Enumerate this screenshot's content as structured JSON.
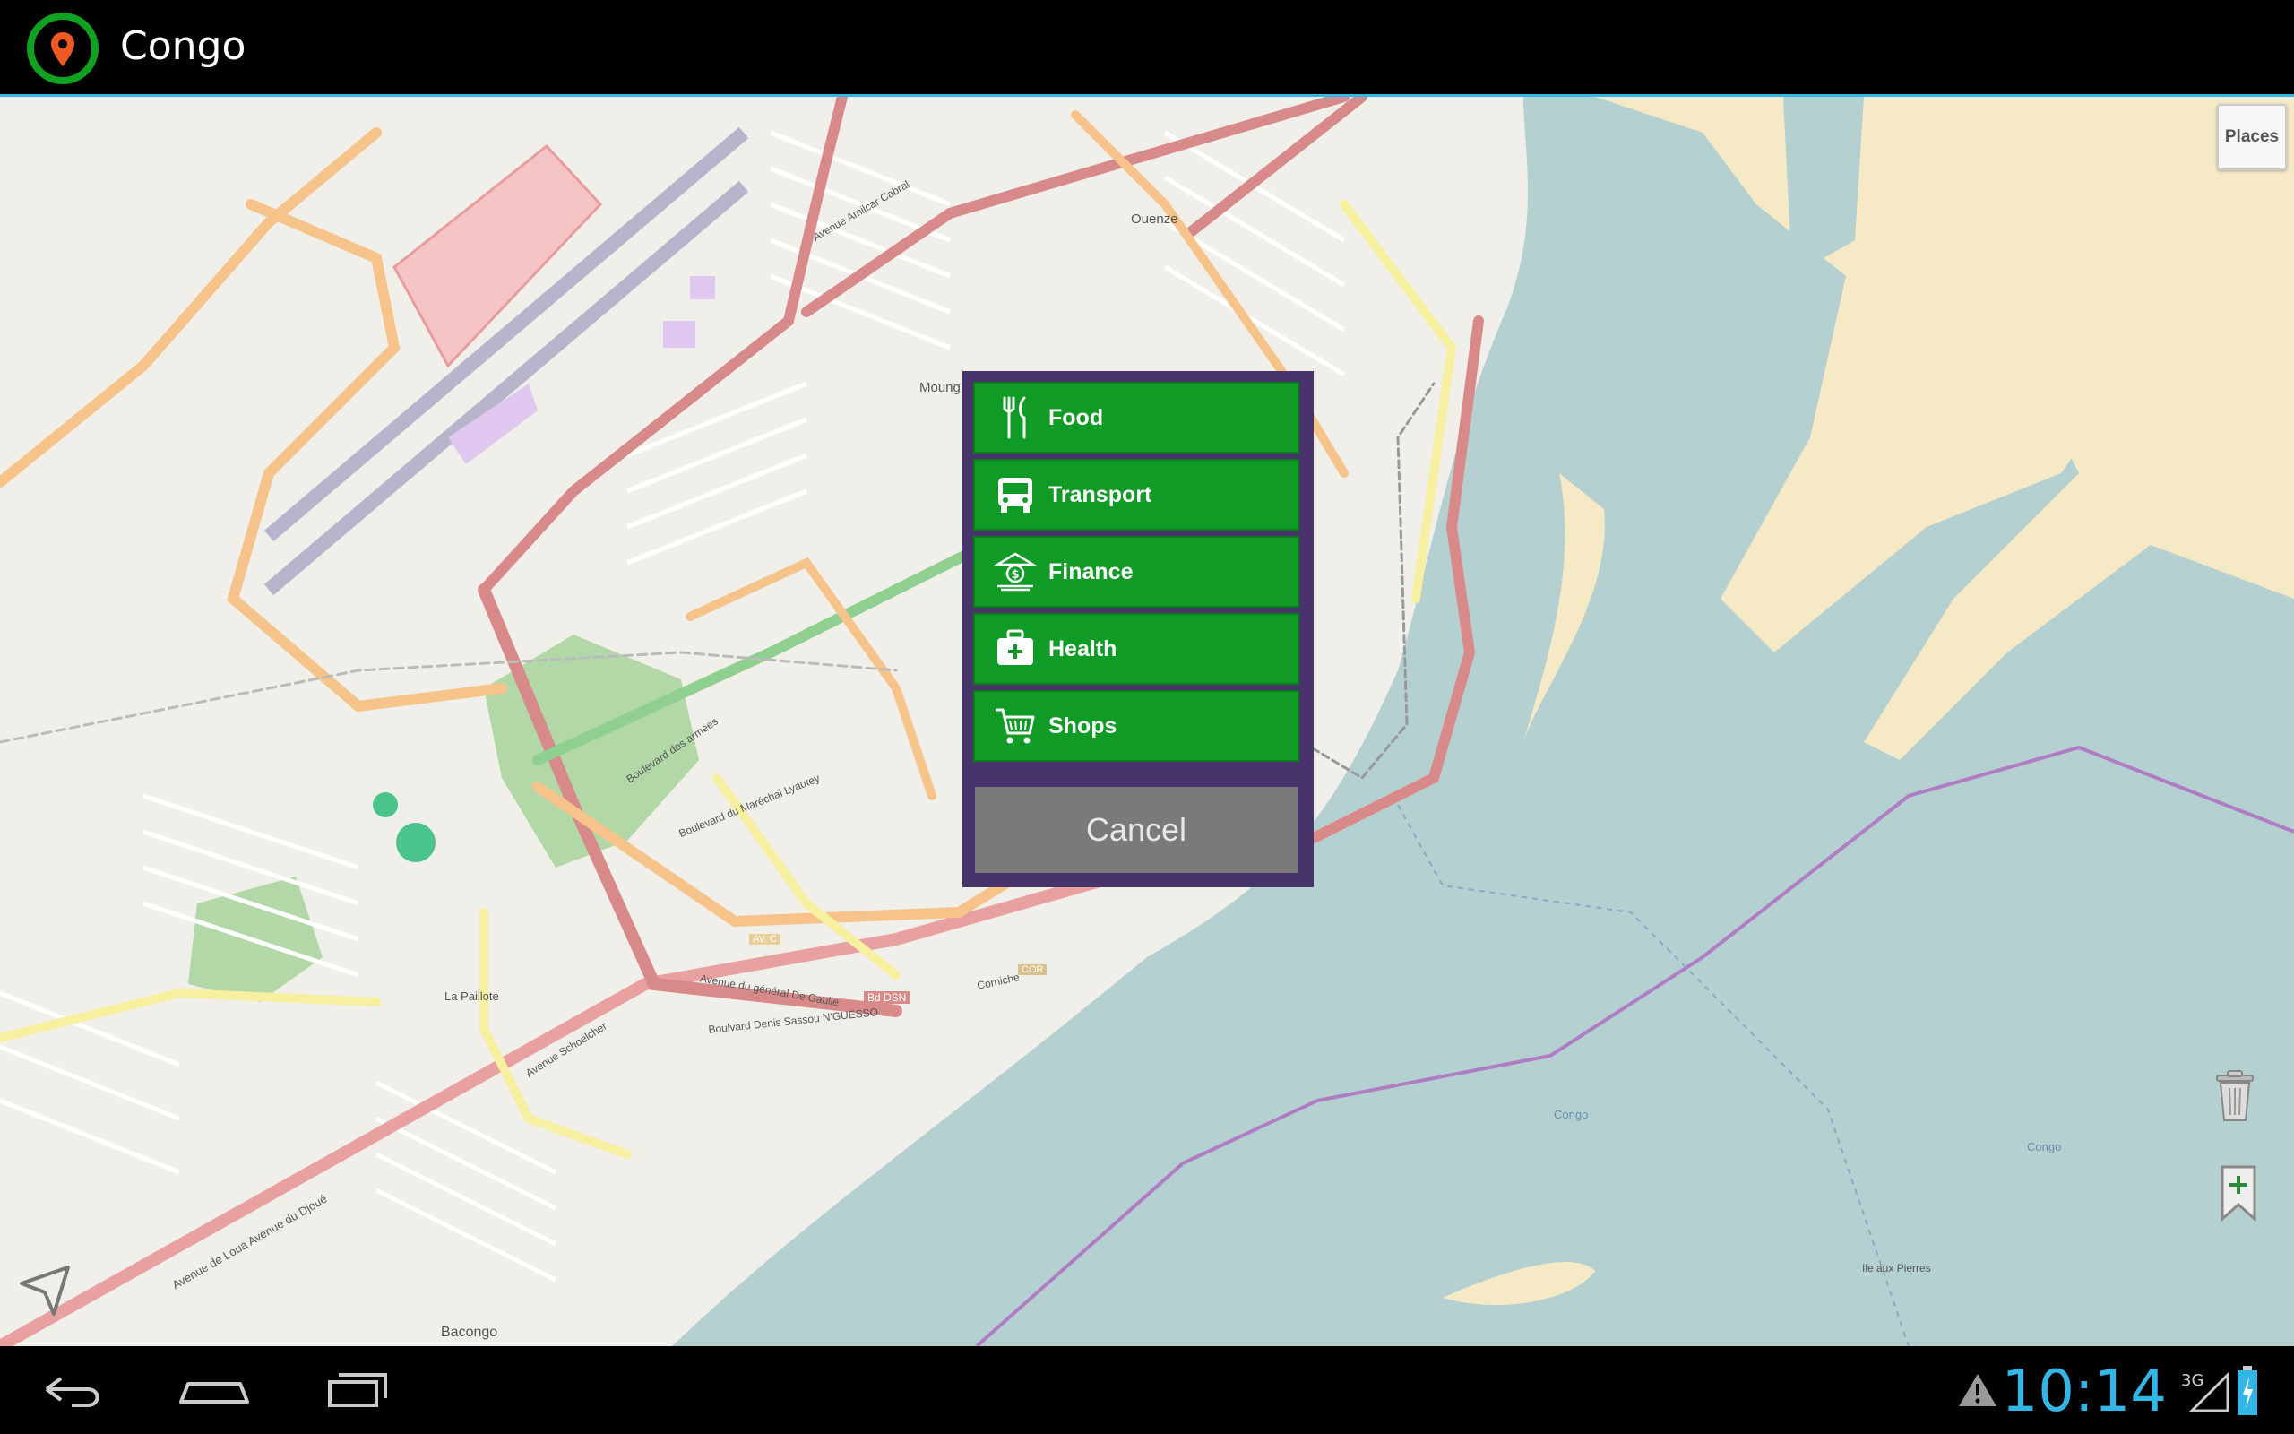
{
  "app": {
    "title": "Congo"
  },
  "map": {
    "places_button": "Places",
    "labels": {
      "ouenze": "Ouenze",
      "moungali": "Moung",
      "la_paillote": "La Paillote",
      "bacongo": "Bacongo",
      "congo_river_1": "Congo",
      "congo_river_2": "Congo",
      "ile_aux_pierres": "Ile aux Pierres",
      "bd_dsn": "Bd DSN",
      "av_c": "AV. C",
      "cor": "COR",
      "avenue_de_loua": "Avenue de Loua  Avenue du Djoué",
      "avenue_schoelcher": "Avenue Schoelcher",
      "boulevard_denis": "Boulvard Denis Sassou N'GUESSO",
      "avenue_general": "Avenue du général De Gaulle",
      "corniche": "Corniche",
      "boulevard_marechal": "Boulevard du Maréchal Lyautey",
      "boulevard_armees": "Boulevard des armées",
      "avenue_amilcar": "Avenue Amilcar Cabral"
    }
  },
  "dialog": {
    "items": [
      {
        "label": "Food",
        "icon": "fork-knife-icon"
      },
      {
        "label": "Transport",
        "icon": "bus-icon"
      },
      {
        "label": "Finance",
        "icon": "bank-icon"
      },
      {
        "label": "Health",
        "icon": "first-aid-kit-icon"
      },
      {
        "label": "Shops",
        "icon": "shopping-cart-icon"
      }
    ],
    "cancel_label": "Cancel"
  },
  "status": {
    "time": "10:14",
    "network": "3G"
  },
  "colors": {
    "accent": "#33b5e5",
    "menu_green": "#0f9b25",
    "dialog_bg": "#47346a",
    "water": "#b5d0d0"
  }
}
